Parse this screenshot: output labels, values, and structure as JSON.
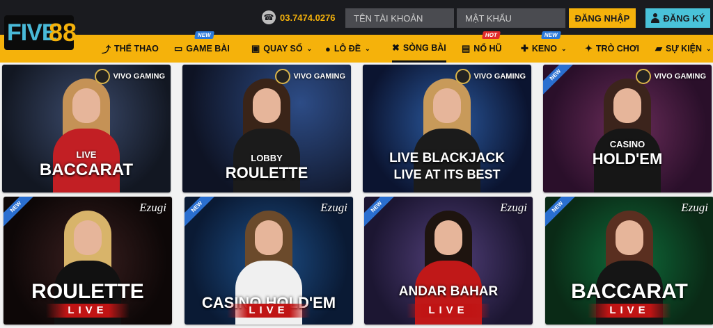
{
  "logo": {
    "part1": "FIVE",
    "part2": "88"
  },
  "header": {
    "phone": "03.7474.0276",
    "username_placeholder": "TÊN TÀI KHOẢN",
    "password_placeholder": "MẬT KHẨU",
    "login_label": "ĐĂNG NHẬP",
    "register_label": "ĐĂNG KÝ"
  },
  "nav": [
    {
      "label": "THỂ THAO",
      "icon": "sport-icon"
    },
    {
      "label": "GAME BÀI",
      "icon": "cards-icon",
      "badge": "NEW"
    },
    {
      "label": "QUAY SỐ",
      "icon": "dice-icon",
      "dropdown": true
    },
    {
      "label": "LÔ ĐỀ",
      "icon": "ball-icon",
      "dropdown": true
    },
    {
      "label": "SÒNG BÀI",
      "icon": "chip-icon",
      "active": true
    },
    {
      "label": "NỔ HŨ",
      "icon": "slot-icon",
      "badge": "HOT"
    },
    {
      "label": "KENO",
      "icon": "keno-icon",
      "badge": "NEW",
      "dropdown": true
    },
    {
      "label": "TRÒ CHƠI",
      "icon": "gamepad-icon"
    },
    {
      "label": "SỰ KIỆN",
      "icon": "gift-icon",
      "dropdown": true
    }
  ],
  "games": [
    {
      "title": "BACCARAT",
      "sub": "LIVE",
      "provider": "VIVO GAMING",
      "new": false
    },
    {
      "title": "ROULETTE",
      "sub": "LOBBY",
      "provider": "VIVO GAMING",
      "new": false
    },
    {
      "title": "LIVE BLACKJACK",
      "sub": "LIVE AT ITS BEST",
      "provider": "VIVO GAMING",
      "new": false
    },
    {
      "title": "HOLD'EM",
      "sub": "CASINO",
      "provider": "VIVO GAMING",
      "new": true
    },
    {
      "title": "ROULETTE",
      "sub": "LIVE",
      "provider": "Ezugi",
      "new": true
    },
    {
      "title": "CASINO HOLD'EM",
      "sub": "LIVE",
      "provider": "Ezugi",
      "new": true
    },
    {
      "title": "ANDAR BAHAR",
      "sub": "LIVE",
      "provider": "Ezugi",
      "new": true
    },
    {
      "title": "BACCARAT",
      "sub": "LIVE",
      "provider": "Ezugi",
      "new": true
    }
  ],
  "labels": {
    "new": "NEW",
    "hot": "HOT"
  }
}
